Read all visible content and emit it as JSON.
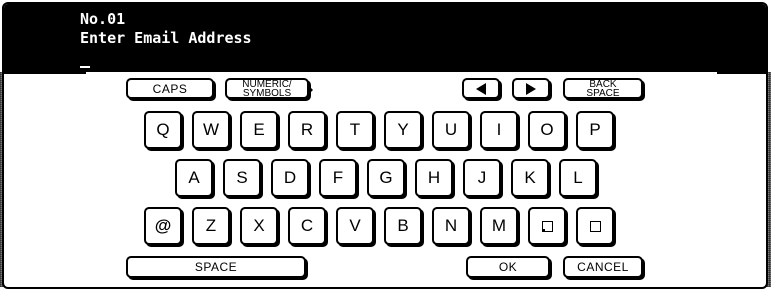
{
  "header": {
    "number": "No.01",
    "prompt": "Enter Email Address",
    "input_value": ""
  },
  "function_keys": {
    "caps": "CAPS",
    "numeric_line1": "NUMERIC/",
    "numeric_line2": "SYMBOLS",
    "back_line1": "BACK",
    "back_line2": "SPACE",
    "left_arrow_icon": "left-arrow-icon",
    "right_arrow_icon": "right-arrow-icon"
  },
  "rows": {
    "row1": [
      "Q",
      "W",
      "E",
      "R",
      "T",
      "Y",
      "U",
      "I",
      "O",
      "P"
    ],
    "row2": [
      "A",
      "S",
      "D",
      "F",
      "G",
      "H",
      "J",
      "K",
      "L"
    ],
    "row3": [
      "@",
      "Z",
      "X",
      "C",
      "V",
      "B",
      "N",
      "M"
    ]
  },
  "bottom": {
    "space": "SPACE",
    "ok": "OK",
    "cancel": "CANCEL"
  },
  "colors": {
    "header_bg": "#000000",
    "header_text": "#ffffff",
    "side_band": "#7a7a7a"
  }
}
